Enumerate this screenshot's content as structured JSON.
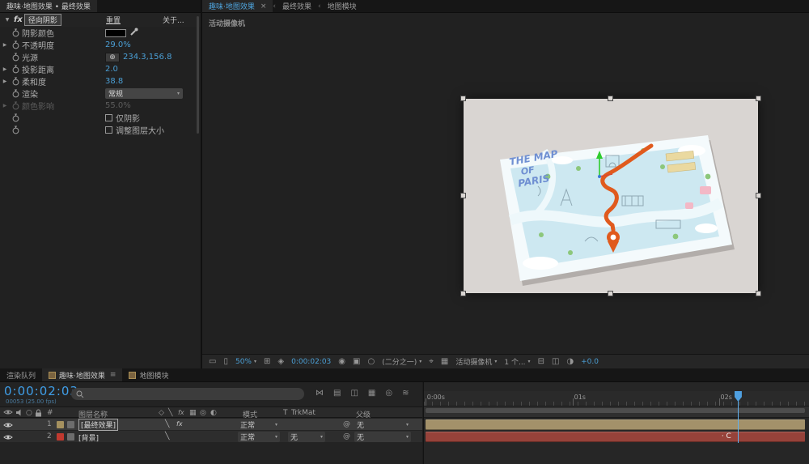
{
  "effect_panel": {
    "tab": "趣味·地图效果 • 最终效果",
    "effect_badge": "fx",
    "effect_name": "径向阴影",
    "reset": "重置",
    "about": "关于...",
    "rows": {
      "shadow_color": {
        "label": "阴影颜色"
      },
      "opacity": {
        "label": "不透明度",
        "value": "29.0%"
      },
      "light_source": {
        "label": "光源",
        "value": "234.3,156.8"
      },
      "shadow_distance": {
        "label": "投影距离",
        "value": "2.0"
      },
      "softness": {
        "label": "柔和度",
        "value": "38.8"
      },
      "render": {
        "label": "渲染",
        "value": "常规"
      },
      "color_influence": {
        "label": "颜色影响",
        "value": "55.0%"
      },
      "shadow_only": {
        "label": "仅阴影"
      },
      "resize_layer": {
        "label": "调整图层大小"
      }
    }
  },
  "viewer": {
    "tabs": [
      {
        "label": "趣味·地图效果"
      },
      {
        "label": "最终效果"
      },
      {
        "label": "地图模块"
      }
    ],
    "camera_label": "活动摄像机",
    "map": {
      "title_line1": "THE MAP",
      "title_line2": "OF",
      "title_line3": "PARIS"
    },
    "toolbar": {
      "zoom": "50%",
      "timecode": "0:00:02:03",
      "resolution": "(二分之一)",
      "camera": "活动摄像机",
      "views": "1 个...",
      "exposure": "+0.0"
    }
  },
  "timeline": {
    "tabs": [
      {
        "label": "渲染队列"
      },
      {
        "label": "趣味·地图效果"
      },
      {
        "label": "地图模块"
      }
    ],
    "timecode": "0:00:02:03",
    "frame_info": "00053 (25.00 fps)",
    "columns": {
      "number": "#",
      "layer_name": "图层名称",
      "mode": "模式",
      "trkmat_t": "T",
      "trkmat": "TrkMat",
      "parent": "父级",
      "solo": "○"
    },
    "layers": [
      {
        "index": "1",
        "name": "[最终效果]",
        "mode": "正常",
        "parent": "无",
        "label_color": "#a5915f",
        "bar_color": "#a3916a"
      },
      {
        "index": "2",
        "name": "[背景]",
        "mode": "正常",
        "trkmat": "无",
        "parent": "无",
        "label_color": "#c0392f",
        "bar_color": "#96423a"
      }
    ],
    "ruler": [
      "0:00s",
      "01s",
      "02s"
    ],
    "marker": "C"
  }
}
